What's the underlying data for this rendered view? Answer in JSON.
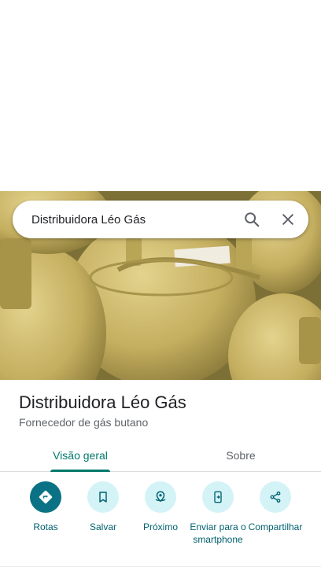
{
  "search": {
    "value": "Distribuidora Léo Gás"
  },
  "place": {
    "name": "Distribuidora Léo Gás",
    "category": "Fornecedor de gás butano"
  },
  "tabs": [
    {
      "label": "Visão geral",
      "active": true
    },
    {
      "label": "Sobre",
      "active": false
    }
  ],
  "actions": [
    {
      "label": "Rotas",
      "icon": "directions-icon"
    },
    {
      "label": "Salvar",
      "icon": "bookmark-icon"
    },
    {
      "label": "Próximo",
      "icon": "nearby-icon"
    },
    {
      "label": "Enviar para o smartphone",
      "icon": "send-to-phone-icon"
    },
    {
      "label": "Compartilhar",
      "icon": "share-icon"
    }
  ],
  "colors": {
    "accent": "#00796b",
    "primary_button": "#0b7285",
    "chip_bg": "#d4f3f7"
  }
}
